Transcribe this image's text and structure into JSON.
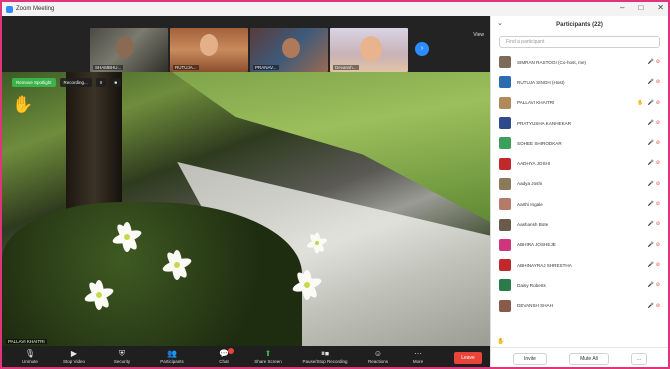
{
  "window": {
    "title": "Zoom Meeting",
    "controls": [
      "–",
      "□",
      "✕"
    ]
  },
  "thumbnails": [
    {
      "name": "SHAMBHU..."
    },
    {
      "name": "RUTUJA..."
    },
    {
      "name": "PRANAV..."
    },
    {
      "name": "Devansh..."
    }
  ],
  "view_label": "View",
  "video": {
    "badges": [
      "Remove Spotlight",
      "Recording...",
      "II",
      "■"
    ],
    "speaker": "PALLAVI KHAITRI"
  },
  "toolbar": {
    "buttons": [
      {
        "label": "Unmute",
        "icon": "microphone-icon"
      },
      {
        "label": "Stop Video",
        "icon": "video-icon"
      },
      {
        "label": "Security",
        "icon": "shield-icon"
      },
      {
        "label": "Participants",
        "icon": "participants-icon",
        "count": "21"
      },
      {
        "label": "Chat",
        "icon": "chat-icon"
      },
      {
        "label": "Share Screen",
        "icon": "share-screen-icon"
      },
      {
        "label": "Pause/Stop Recording",
        "icon": "recording-icon"
      },
      {
        "label": "Reactions",
        "icon": "reactions-icon"
      },
      {
        "label": "More",
        "icon": "more-icon"
      }
    ],
    "end_label": "Leave"
  },
  "panel": {
    "title": "Participants (22)",
    "search_placeholder": "Find a participant",
    "participants": [
      {
        "name": "SIMRAN RASTOGI (Co-host, me)",
        "color": "#7e6a5a",
        "hand": false,
        "mic": "muted"
      },
      {
        "name": "RUTUJA SINGH (Host)",
        "color": "#2d6cb0",
        "hand": false,
        "mic": "muted"
      },
      {
        "name": "PALLAVI KHAITRI",
        "color": "#b08a5a",
        "hand": true,
        "mic": "on"
      },
      {
        "name": "PRATYUSHA KANHEKAR",
        "color": "#2e4a8c",
        "hand": false,
        "mic": "on"
      },
      {
        "name": "SOHEE SHIRODKAR",
        "color": "#3aa05a",
        "hand": false,
        "mic": "on"
      },
      {
        "name": "AADHYA JOSHI",
        "color": "#c0282c",
        "hand": false,
        "mic": "muted"
      },
      {
        "name": "Aadya Joshi",
        "color": "#8a7a5a",
        "hand": false,
        "mic": "muted"
      },
      {
        "name": "Aarthi Ingale",
        "color": "#b57a6a",
        "hand": false,
        "mic": "muted"
      },
      {
        "name": "Aashansh Bote",
        "color": "#6a5a4a",
        "hand": false,
        "mic": "muted"
      },
      {
        "name": "ABHIRA JOSHEJE",
        "color": "#d0357c",
        "hand": false,
        "mic": "muted"
      },
      {
        "name": "ABHINAYRAJ SHRESTHA",
        "color": "#c0282c",
        "hand": false,
        "mic": "muted"
      },
      {
        "name": "Daisy Roberts",
        "color": "#2a7a4a",
        "hand": false,
        "mic": "muted"
      },
      {
        "name": "DEVANSH SHAH",
        "color": "#8a5a4a",
        "hand": false,
        "mic": "muted"
      }
    ],
    "footer": {
      "invite": "Invite",
      "mute_all": "Mute All",
      "more": "..."
    }
  }
}
